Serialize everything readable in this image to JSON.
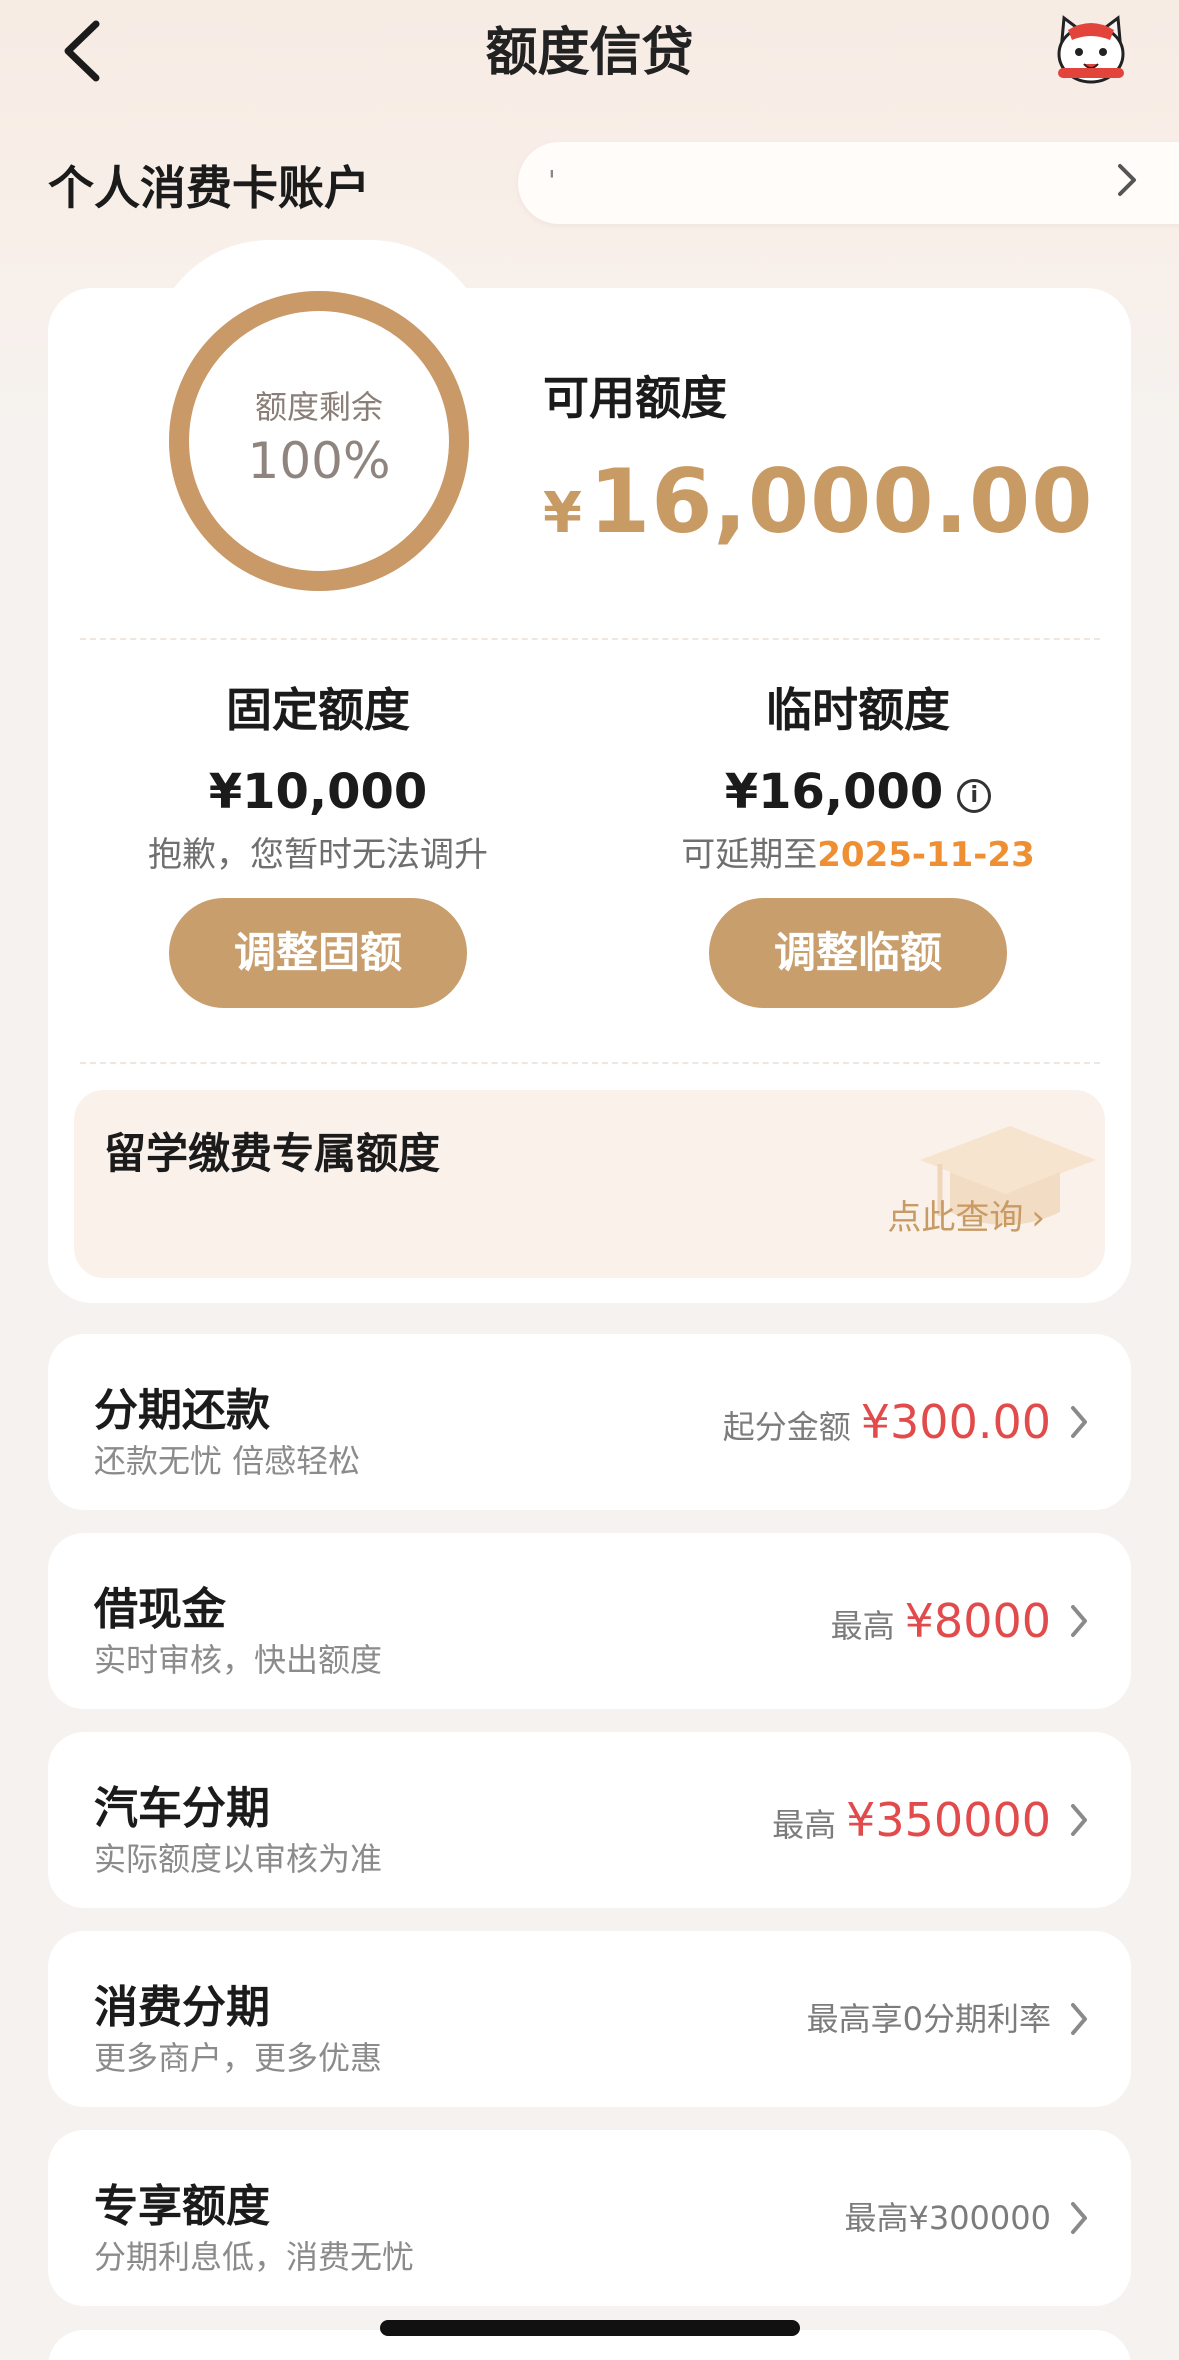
{
  "header": {
    "title": "额度信贷"
  },
  "account": {
    "label": "个人消费卡账户",
    "pill_text": "'"
  },
  "gauge": {
    "label": "额度剩余",
    "percent_text": "100%",
    "remaining_fraction": 1.0
  },
  "available": {
    "title": "可用额度",
    "currency": "¥",
    "amount": "16,000.00"
  },
  "fixed": {
    "title": "固定额度",
    "amount": "¥10,000",
    "note": "抱歉，您暂时无法调升",
    "button": "调整固额"
  },
  "temporary": {
    "title": "临时额度",
    "amount": "¥16,000",
    "info_icon": "i",
    "note_prefix": "可延期至",
    "date": "2025-11-23",
    "button": "调整临额"
  },
  "study": {
    "title": "留学缴费专属额度",
    "link": "点此查询",
    "link_chevron": "›"
  },
  "services": [
    {
      "title": "分期还款",
      "subtitle": "还款无忧 倍感轻松",
      "right_label": "起分金额",
      "right_value": "¥300.00"
    },
    {
      "title": "借现金",
      "subtitle": "实时审核，快出额度",
      "right_label": "最高",
      "right_value": "¥8000"
    },
    {
      "title": "汽车分期",
      "subtitle": "实际额度以审核为准",
      "right_label": "最高",
      "right_value": "¥350000"
    },
    {
      "title": "消费分期",
      "subtitle": "更多商户，更多优惠",
      "right_label": "最高享0分期利率",
      "right_value": ""
    },
    {
      "title": "专享额度",
      "subtitle": "分期利息低，消费无忧",
      "right_label": "最高¥300000",
      "right_value": ""
    }
  ],
  "colors": {
    "gold": "#c89a64",
    "button_gold": "#c89e6c",
    "price_red": "#e24b4b",
    "date_orange": "#ee8f33"
  }
}
